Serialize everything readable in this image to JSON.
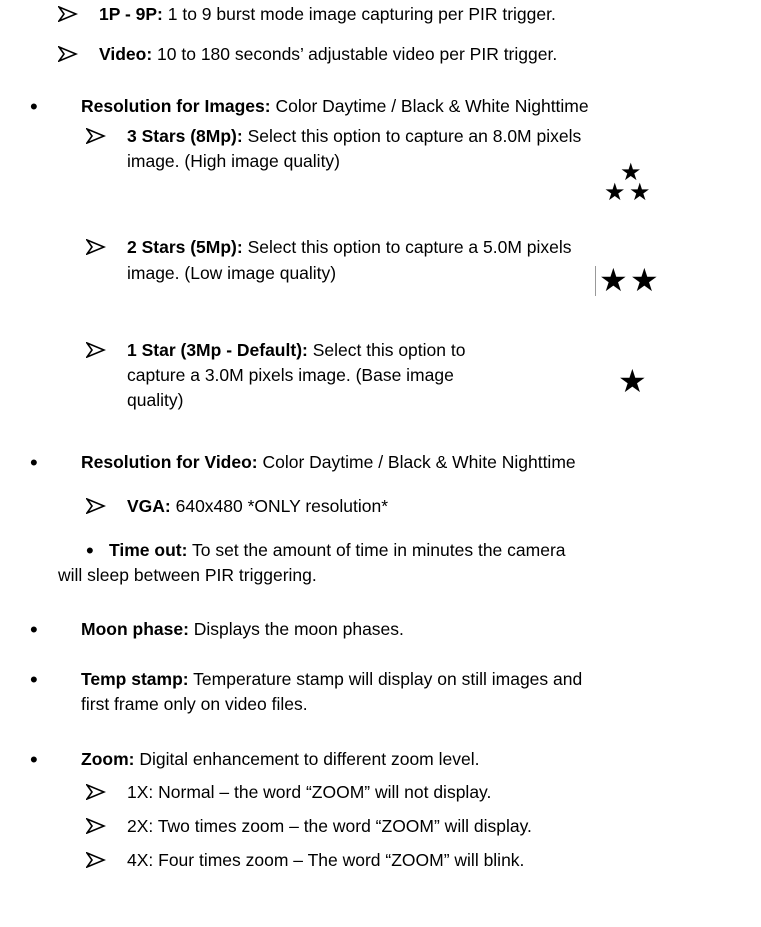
{
  "items": {
    "burst": {
      "label": "1P - 9P:",
      "text": " 1 to 9 burst mode image capturing per PIR trigger."
    },
    "video": {
      "label": "Video:",
      "text": " 10 to 180 seconds’ adjustable video per PIR trigger."
    },
    "res_images": {
      "label": "Resolution for Images:",
      "text": "  Color Daytime / Black & White Nighttime"
    },
    "stars3": {
      "label": "3 Stars (8Mp):",
      "text": " Select this option to capture an 8.0M pixels",
      "line2": "image. (High image quality)"
    },
    "stars2": {
      "label": "2 Stars (5Mp):",
      "text": " Select this option to capture a 5.0M pixels",
      "line2": "image. (Low image quality)"
    },
    "star1": {
      "label": "1 Star (3Mp - Default):",
      "text": " Select this option to",
      "line2": "capture a 3.0M pixels image. (Base image",
      "line3": "quality)"
    },
    "res_video": {
      "label": "Resolution for Video:",
      "text": " Color Daytime / Black & White Nighttime"
    },
    "vga": {
      "label": "VGA:",
      "text": "  640x480 *ONLY resolution*"
    },
    "timeout": {
      "label": "Time out:",
      "text": " To set the amount of time in minutes the camera",
      "line2": "will sleep between PIR triggering."
    },
    "moon": {
      "label": "Moon phase:",
      "text": " Displays the moon phases."
    },
    "temp": {
      "label": "Temp stamp:",
      "text": " Temperature stamp will display on still images and",
      "line2": "first frame only on video files."
    },
    "zoom": {
      "label": "Zoom:",
      "text": "  Digital enhancement to different zoom level."
    },
    "zoom1": {
      "text": "1X: Normal – the word “ZOOM” will not display."
    },
    "zoom2": {
      "text": "2X: Two times zoom – the word “ZOOM” will display."
    },
    "zoom4": {
      "text": "4X: Four times zoom – The word “ZOOM” will blink."
    }
  },
  "glyphs": {
    "star": "★",
    "bullet": "•"
  }
}
